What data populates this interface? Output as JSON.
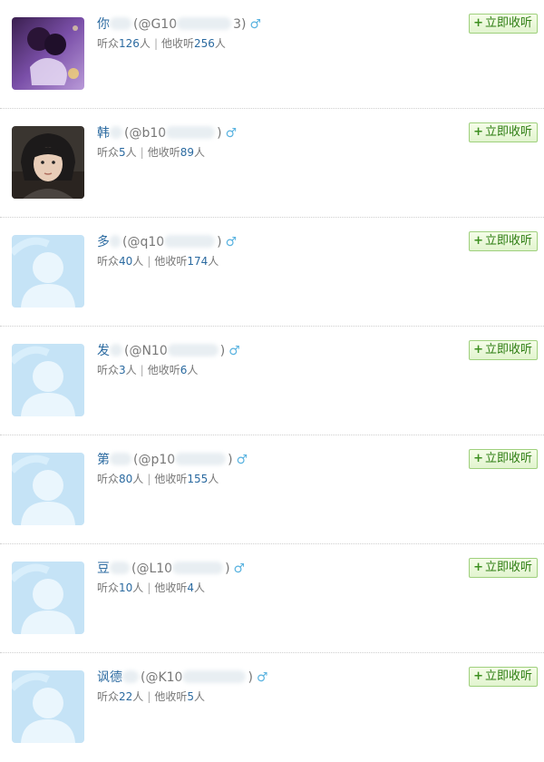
{
  "follow_label": "立即收听",
  "plus_symbol": "+",
  "gender_symbol": "♂",
  "labels": {
    "listeners": "听众",
    "following": "他收听",
    "people_unit": "人",
    "separator": "|"
  },
  "users": [
    {
      "name": "你",
      "handle_start": "(@G10",
      "handle_end": "3)",
      "listeners": "126",
      "following": "256",
      "avatar": "photo-purple"
    },
    {
      "name": "韩",
      "handle_start": "(@b10",
      "handle_end": ")",
      "listeners": "5",
      "following": "89",
      "avatar": "photo-person"
    },
    {
      "name": "多",
      "handle_start": "(@q10",
      "handle_end": ")",
      "listeners": "40",
      "following": "174",
      "avatar": "default"
    },
    {
      "name": "发",
      "handle_start": "(@N10",
      "handle_end": ")",
      "listeners": "3",
      "following": "6",
      "avatar": "default"
    },
    {
      "name": "第",
      "handle_start": "(@p10",
      "handle_end": ")",
      "listeners": "80",
      "following": "155",
      "avatar": "default"
    },
    {
      "name": "豆",
      "handle_start": "(@L10",
      "handle_end": ")",
      "listeners": "10",
      "following": "4",
      "avatar": "default"
    },
    {
      "name": "讽德",
      "handle_start": "(@K10",
      "handle_end": ")",
      "listeners": "22",
      "following": "5",
      "avatar": "default"
    }
  ]
}
